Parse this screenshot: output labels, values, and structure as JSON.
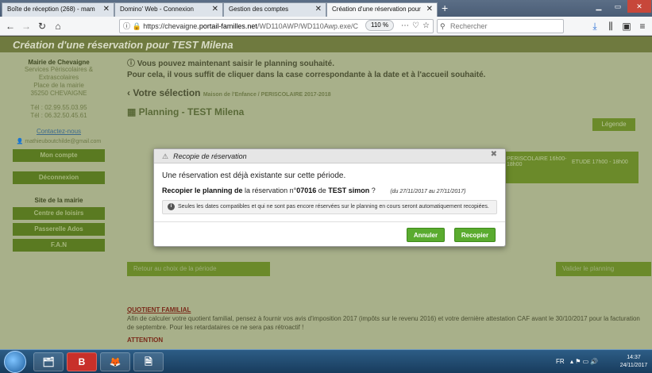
{
  "browser": {
    "tabs": [
      {
        "label": "Boîte de réception (268) - mam",
        "active": false
      },
      {
        "label": "Domino' Web - Connexion",
        "active": false
      },
      {
        "label": "Gestion des comptes",
        "active": false
      },
      {
        "label": "Création d'une réservation pour TE",
        "active": true
      }
    ],
    "url": {
      "prefix": "https://chevaigne.",
      "host": "portail-familles.net",
      "path": "/WD110AWP/WD110Awp.exe/C"
    },
    "zoom": "110 %",
    "search_placeholder": "Rechercher"
  },
  "page": {
    "header": "Création d'une réservation pour TEST Milena",
    "sidebar": {
      "org_title": "Mairie de Chevaigne",
      "org_lines": [
        "Services Périscolaires &",
        "Extrascolaires",
        "Place de la mairie",
        "35250 CHEVAIGNE"
      ],
      "tel1": "Tél : 02.99.55.03.95",
      "tel2": "Tél : 06.32.50.45.61",
      "contact_link": "Contactez-nous",
      "email": "mathieuboutchilde@gmail.com",
      "btn_account": "Mon compte",
      "btn_logout": "Déconnexion",
      "section_title": "Site de la mairie",
      "btn_centre": "Centre de loisirs",
      "btn_passerelle": "Passerelle Ados",
      "btn_fan": "F.A.N"
    },
    "main": {
      "info_line1": "Vous pouvez maintenant saisir le planning souhaité.",
      "info_line2": "Pour cela, il vous suffit de cliquer dans la case correspondante à la date et à l'accueil souhaité.",
      "selection_label": "Votre sélection",
      "selection_detail": "Maison de l'Enfance / PERISCOLAIRE 2017-2018",
      "planning_label": "Planning - TEST Milena",
      "legend_btn": "Légende",
      "green_head_1": "PERISCOLAIRE 16h00-18h00",
      "green_head_2": "ETUDE 17h00 - 18h00",
      "btn_back": "Retour au choix de la période",
      "btn_validate": "Valider le planning",
      "qf_title": "QUOTIENT FAMILIAL",
      "qf_text": "Afin de calculer votre quotient familial, pensez à fournir vos avis d'imposition 2017 (impôts sur le revenu 2016) et votre dernière attestation CAF avant le 30/10/2017 pour la facturation de septembre. Pour les retardataires ce ne sera pas rétroactif !",
      "attn_title": "ATTENTION"
    }
  },
  "modal": {
    "title": "Recopie de réservation",
    "line1": "Une réservation est déjà existante sur cette période.",
    "line2_prefix": "Recopier le planning de",
    "line2_mid": "la réservation n°",
    "reservation_no": "07016",
    "line2_de": "de",
    "person": "TEST simon",
    "line2_q": "?",
    "dates": "(du 27/11/2017 au 27/11/2017)",
    "note": "Seules les dates compatibles et qui ne sont pas encore réservées sur le planning en cours seront automatiquement recopiées.",
    "btn_cancel": "Annuler",
    "btn_copy": "Recopier"
  },
  "taskbar": {
    "lang": "FR",
    "time": "14:37",
    "date": "24/11/2017"
  }
}
